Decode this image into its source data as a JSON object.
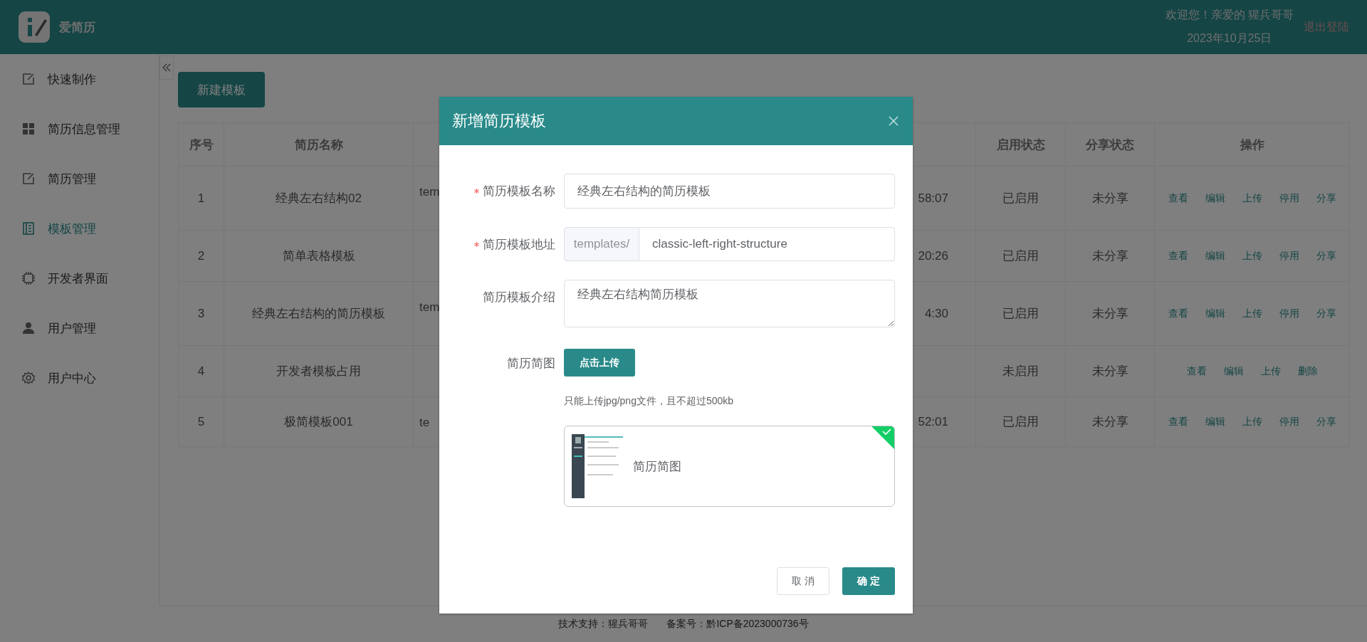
{
  "header": {
    "app_name": "爱简历",
    "welcome": "欢迎您！亲爱的 猩兵哥哥",
    "date": "2023年10月25日",
    "logout": "退出登陆"
  },
  "sidebar": {
    "items": [
      {
        "label": "快速制作",
        "selected": false
      },
      {
        "label": "简历信息管理",
        "selected": false
      },
      {
        "label": "简历管理",
        "selected": false
      },
      {
        "label": "模板管理",
        "selected": true
      },
      {
        "label": "开发者界面",
        "selected": false
      },
      {
        "label": "用户管理",
        "selected": false
      },
      {
        "label": "用户中心",
        "selected": false
      }
    ]
  },
  "toolbar": {
    "new_button": "新建模板"
  },
  "table": {
    "columns": [
      "序号",
      "简历名称",
      "启用状态",
      "分享状态",
      "操作"
    ],
    "rows": [
      {
        "index": "1",
        "name": "经典左右结构02",
        "column_3": "tem",
        "column_4": "58:07",
        "enabled_status": "已启用",
        "share_status": "未分享",
        "actions": [
          "查看",
          "编辑",
          "上传",
          "停用",
          "分享"
        ]
      },
      {
        "index": "2",
        "name": "简单表格模板",
        "column_4": "20:26",
        "enabled_status": "已启用",
        "share_status": "未分享",
        "actions": [
          "查看",
          "编辑",
          "上传",
          "停用",
          "分享"
        ]
      },
      {
        "index": "3",
        "name": "经典左右结构的简历模板",
        "column_3": "tem",
        "column_4": "4:30",
        "enabled_status": "已启用",
        "share_status": "未分享",
        "actions": [
          "查看",
          "编辑",
          "上传",
          "停用",
          "分享"
        ]
      },
      {
        "index": "4",
        "name": "开发者模板占用",
        "enabled_status": "未启用",
        "share_status": "未分享",
        "actions": [
          "查看",
          "编辑",
          "上传",
          "删除"
        ]
      },
      {
        "index": "5",
        "name": "极简模板001",
        "column_3": "te",
        "column_4": "52:01",
        "enabled_status": "已启用",
        "share_status": "未分享",
        "actions": [
          "查看",
          "编辑",
          "上传",
          "停用",
          "分享"
        ]
      }
    ]
  },
  "dialog": {
    "title": "新增简历模板",
    "fields": [
      {
        "kind": "text",
        "label": "简历模板名称",
        "required": true,
        "value": "经典左右结构的简历模板"
      },
      {
        "kind": "prefixed",
        "label": "简历模板地址",
        "required": true,
        "prefix": "templates/",
        "value": "classic-left-right-structure"
      },
      {
        "kind": "textarea",
        "label": "简历模板介绍",
        "required": false,
        "value": "经典左右结构简历模板"
      },
      {
        "kind": "upload",
        "label": "简历简图",
        "required": false,
        "button": "点击上传",
        "hint": "只能上传jpg/png文件，且不超过500kb",
        "file": {
          "name": "简历简图",
          "uploaded": true
        }
      }
    ],
    "buttons": [
      {
        "kind": "default",
        "label": "取 消"
      },
      {
        "kind": "primary",
        "label": "确 定"
      }
    ]
  },
  "footer": [
    "技术支持：猩兵哥哥",
    "备案号：黔ICP备2023000736号"
  ]
}
